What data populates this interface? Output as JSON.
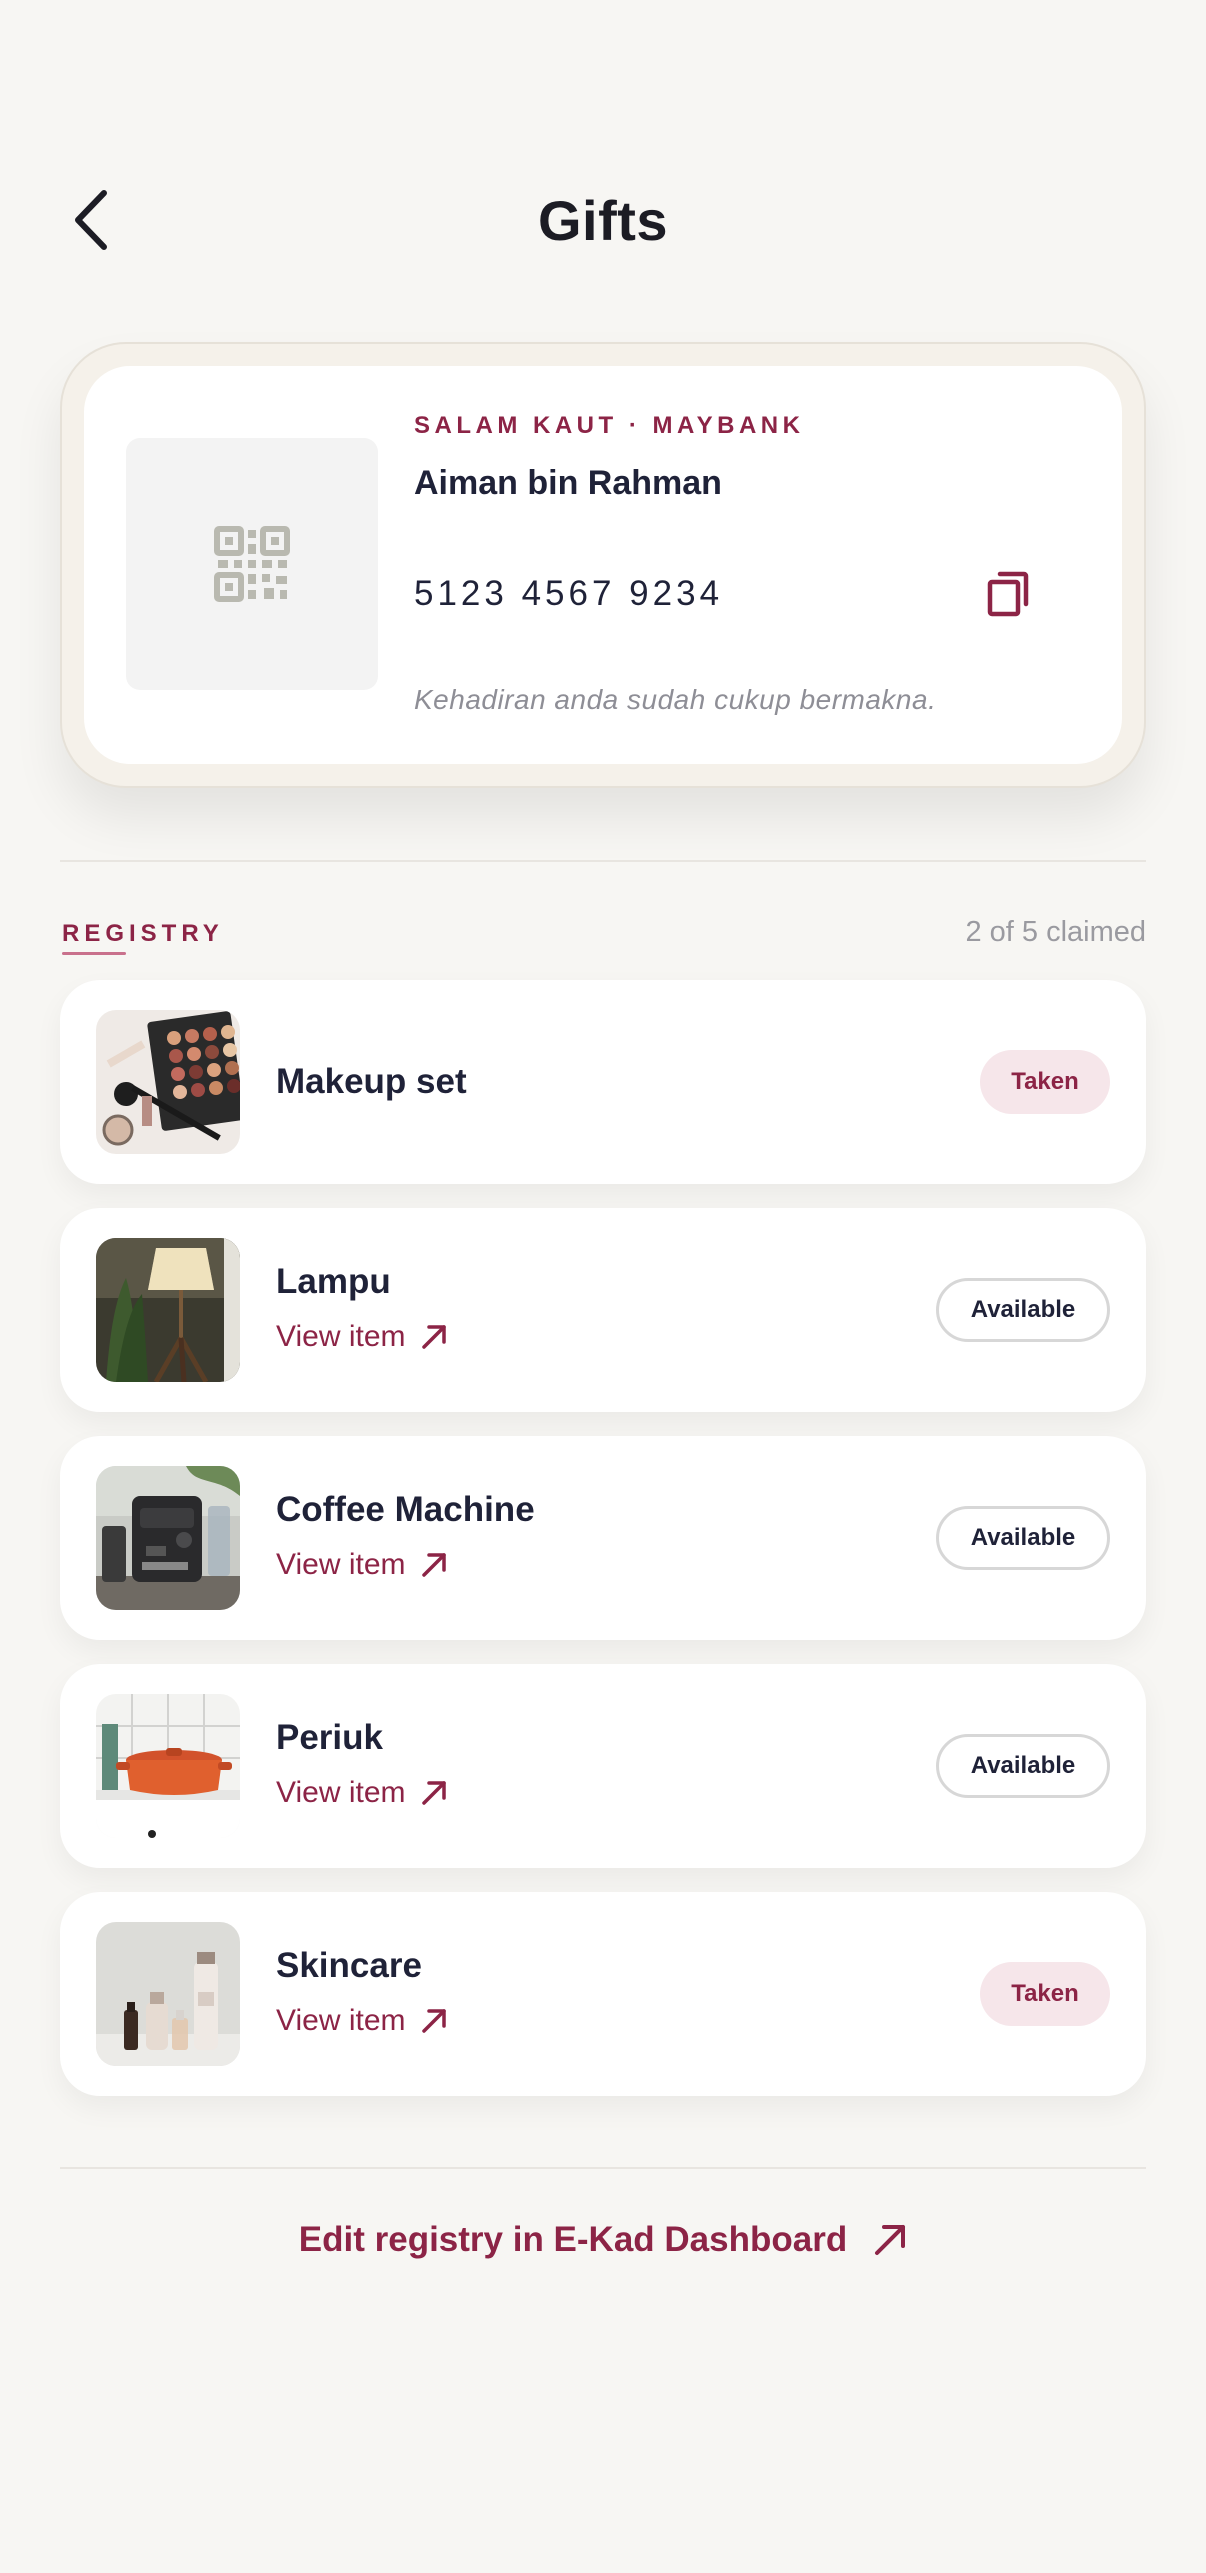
{
  "header": {
    "title": "Gifts"
  },
  "bank_card": {
    "label": "SALAM KAUT · MAYBANK",
    "holder": "Aiman bin Rahman",
    "account_number": "5123 4567 9234",
    "note": "Kehadiran anda sudah cukup bermakna."
  },
  "registry": {
    "label": "REGISTRY",
    "claimed": "2 of 5 claimed",
    "items": [
      {
        "name": "Makeup set",
        "status": "Taken"
      },
      {
        "name": "Lampu",
        "link": "View item",
        "status": "Available"
      },
      {
        "name": "Coffee Machine",
        "link": "View item",
        "status": "Available"
      },
      {
        "name": "Periuk",
        "link": "View item",
        "status": "Available"
      },
      {
        "name": "Skincare",
        "link": "View item",
        "status": "Taken"
      }
    ]
  },
  "footer": {
    "edit_link": "Edit registry in E-Kad Dashboard"
  },
  "colors": {
    "accent": "#8c2446",
    "background": "#f7f6f3",
    "taken_badge_bg": "#f6e6ea"
  }
}
